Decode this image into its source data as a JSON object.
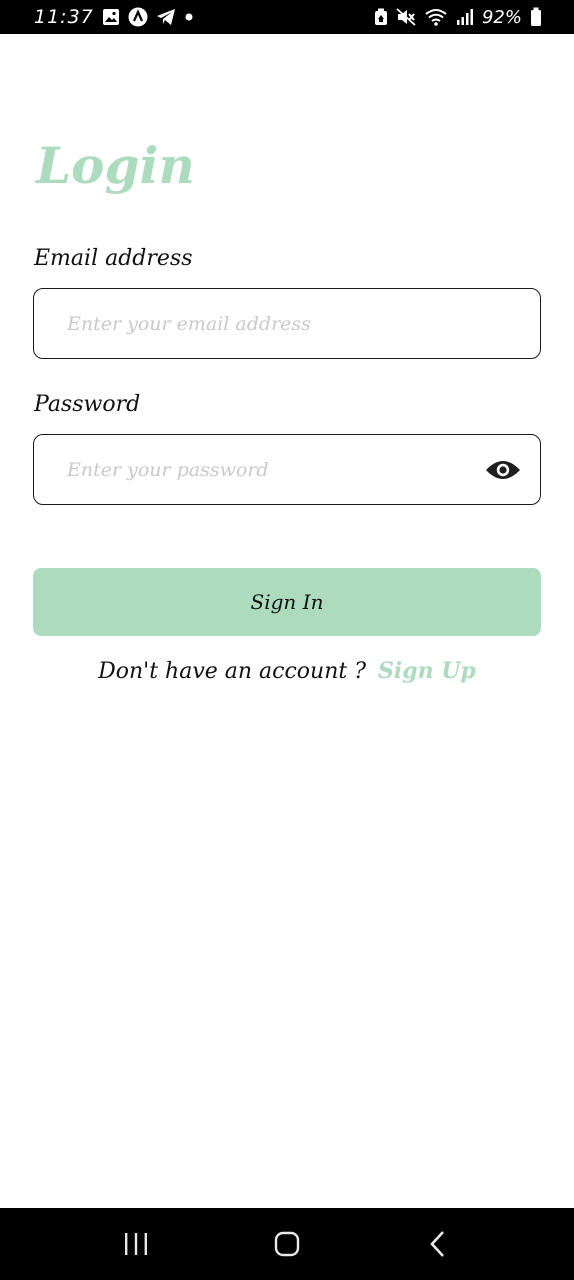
{
  "status_bar": {
    "time": "11:37",
    "battery_percent": "92%",
    "left_icons": [
      "gallery-icon",
      "app-a-icon",
      "telegram-icon",
      "dot-icon"
    ],
    "right_icons": [
      "battery-saver-icon",
      "mute-icon",
      "wifi-icon",
      "signal-icon",
      "battery-icon"
    ]
  },
  "login": {
    "title": "Login",
    "email": {
      "label": "Email address",
      "placeholder": "Enter your email address",
      "value": ""
    },
    "password": {
      "label": "Password",
      "placeholder": "Enter your password",
      "value": "",
      "toggle_icon": "eye-icon"
    },
    "signin_label": "Sign In",
    "signup_prompt": "Don't have an account ?",
    "signup_link": "Sign Up"
  },
  "colors": {
    "accent": "#acdbbe",
    "text": "#111111",
    "placeholder": "#c9c9c9",
    "system_bar": "#000000"
  },
  "nav_bar": {
    "buttons": [
      "recents-icon",
      "home-icon",
      "back-icon"
    ]
  }
}
